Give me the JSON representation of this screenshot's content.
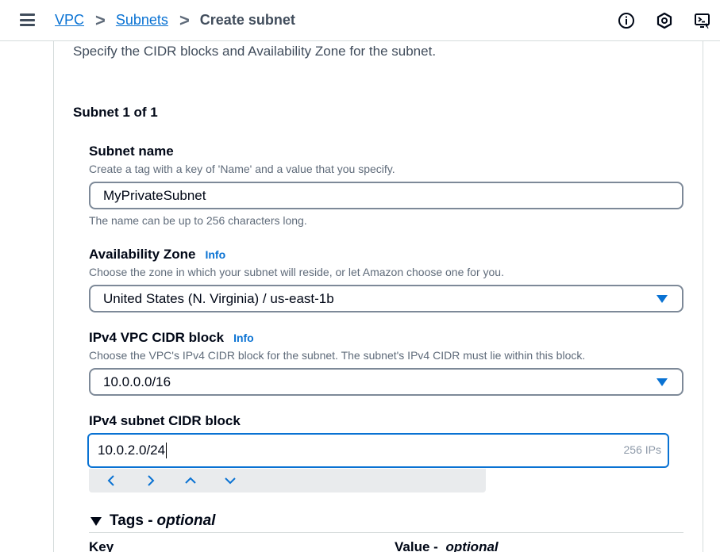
{
  "breadcrumb": {
    "items": [
      "VPC",
      "Subnets"
    ],
    "separator": ">",
    "current": "Create subnet"
  },
  "top_icons": [
    "info-icon",
    "settings-hexagon-icon",
    "cloudshell-icon"
  ],
  "section": {
    "description": "Specify the CIDR blocks and Availability Zone for the subnet.",
    "heading": "Subnet 1 of 1"
  },
  "subnet_name": {
    "label": "Subnet name",
    "hint": "Create a tag with a key of 'Name' and a value that you specify.",
    "value": "MyPrivateSubnet",
    "constraint": "The name can be up to 256 characters long."
  },
  "availability_zone": {
    "label": "Availability Zone",
    "info": "Info",
    "hint": "Choose the zone in which your subnet will reside, or let Amazon choose one for you.",
    "value": "United States (N. Virginia) / us-east-1b"
  },
  "vpc_cidr": {
    "label": "IPv4 VPC CIDR block",
    "info": "Info",
    "hint": "Choose the VPC's IPv4 CIDR block for the subnet. The subnet's IPv4 CIDR must lie within this block.",
    "value": "10.0.0.0/16"
  },
  "subnet_cidr": {
    "label": "IPv4 subnet CIDR block",
    "value": "10.0.2.0/24",
    "ip_count": "256 IPs"
  },
  "ime_toolbar": [
    "left-arrow-icon",
    "right-arrow-icon",
    "up-arrow-icon",
    "down-arrow-icon"
  ],
  "tags": {
    "label": "Tags - ",
    "optional": "optional",
    "key_header": "Key",
    "value_header": "Value - ",
    "value_optional": "optional"
  },
  "colors": {
    "link": "#0972d3",
    "text": "#000716",
    "muted": "#5f6b7a",
    "border": "#7d8998"
  }
}
